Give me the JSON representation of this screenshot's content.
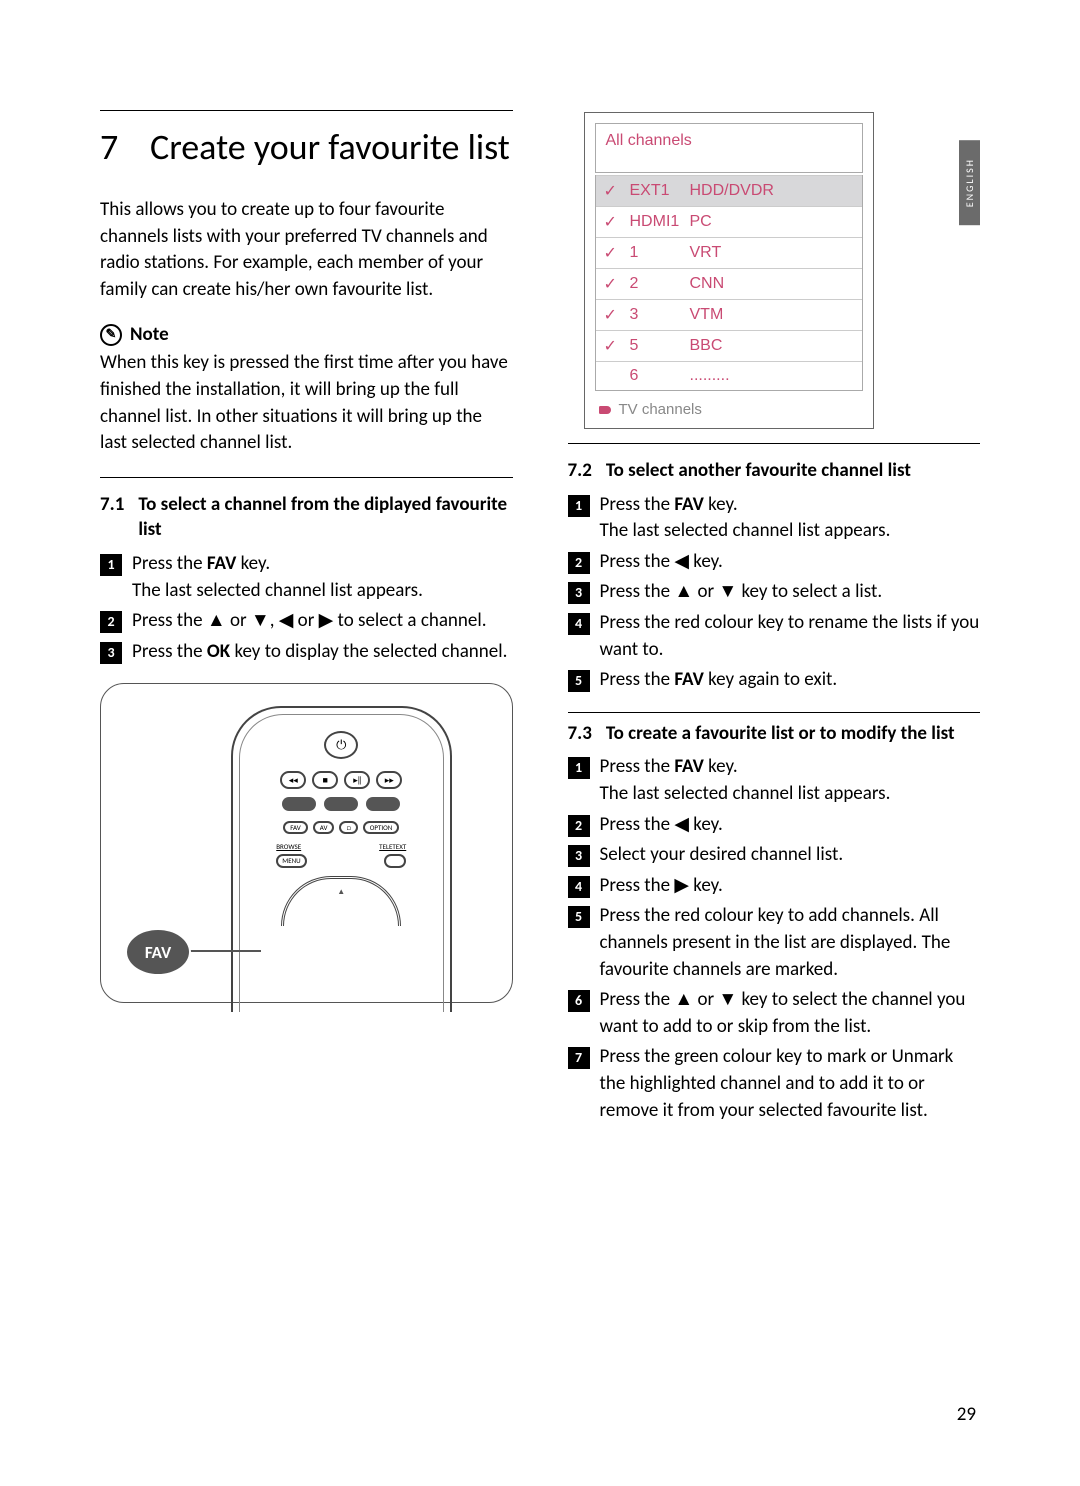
{
  "language_tab": "ENGLISH",
  "page_number": "29",
  "chapter": {
    "number": "7",
    "title": "Create your favourite list"
  },
  "intro": "This allows you to create up to four favourite channels lists with your preferred TV channels and radio stations. For example, each member of your family can create his/her own favourite list.",
  "note": {
    "label": "Note",
    "text": "When this key is pressed the first time after you have finished the installation, it will bring up the full channel list. In other situations it will bring up the last selected channel list."
  },
  "section71": {
    "number": "7.1",
    "title": "To select a channel from the diplayed favourite list",
    "steps": [
      {
        "a": "Press the ",
        "b": "FAV",
        "c": " key.",
        "d": "The last selected channel list appears."
      },
      {
        "a": "Press the ▲ or ▼, ◀ or ▶ to select a channel."
      },
      {
        "a": "Press the ",
        "b": "OK",
        "c": " key to display the selected channel."
      }
    ]
  },
  "remote": {
    "callout": "FAV",
    "rowt": [
      "FAV",
      "AV",
      "□",
      "OPTION"
    ],
    "labels": [
      "BROWSE",
      "TELETEXT"
    ],
    "labels2": [
      "MENU",
      ""
    ]
  },
  "osd": {
    "header": "All channels",
    "rows": [
      {
        "ck": "✓",
        "num": "EXT1",
        "name": "HDD/DVDR"
      },
      {
        "ck": "✓",
        "num": "HDMI1",
        "name": "PC"
      },
      {
        "ck": "✓",
        "num": "1",
        "name": "VRT"
      },
      {
        "ck": "✓",
        "num": "2",
        "name": "CNN"
      },
      {
        "ck": "✓",
        "num": "3",
        "name": "VTM"
      },
      {
        "ck": "✓",
        "num": "5",
        "name": "BBC"
      },
      {
        "ck": "",
        "num": "6",
        "name": "........."
      }
    ],
    "footer": "TV channels"
  },
  "section72": {
    "number": "7.2",
    "title": "To select another favourite channel list",
    "steps": [
      {
        "a": "Press the ",
        "b": "FAV",
        "c": " key.",
        "d": "The last selected channel list appears."
      },
      {
        "a": "Press the ◀ key."
      },
      {
        "a": "Press the ▲ or ▼ key to select a list."
      },
      {
        "a": "Press the red colour key to rename the lists if you want to."
      },
      {
        "a": "Press the ",
        "b": "FAV",
        "c": " key again to exit."
      }
    ]
  },
  "section73": {
    "number": "7.3",
    "title": "To create a favourite list or to modify the list",
    "steps": [
      {
        "a": "Press the ",
        "b": "FAV",
        "c": " key.",
        "d": "The last selected channel list appears."
      },
      {
        "a": "Press the ◀ key."
      },
      {
        "a": "Select your desired channel list."
      },
      {
        "a": "Press the ▶ key."
      },
      {
        "a": "Press the red colour key to add channels. All channels present in the list are displayed. The favourite channels are marked."
      },
      {
        "a": "Press the ▲ or ▼ key to select the channel you want to add to or skip from the list."
      },
      {
        "a": "Press the green colour key to mark or Unmark the highlighted channel and to add it to or remove it from your selected favourite list."
      }
    ]
  }
}
